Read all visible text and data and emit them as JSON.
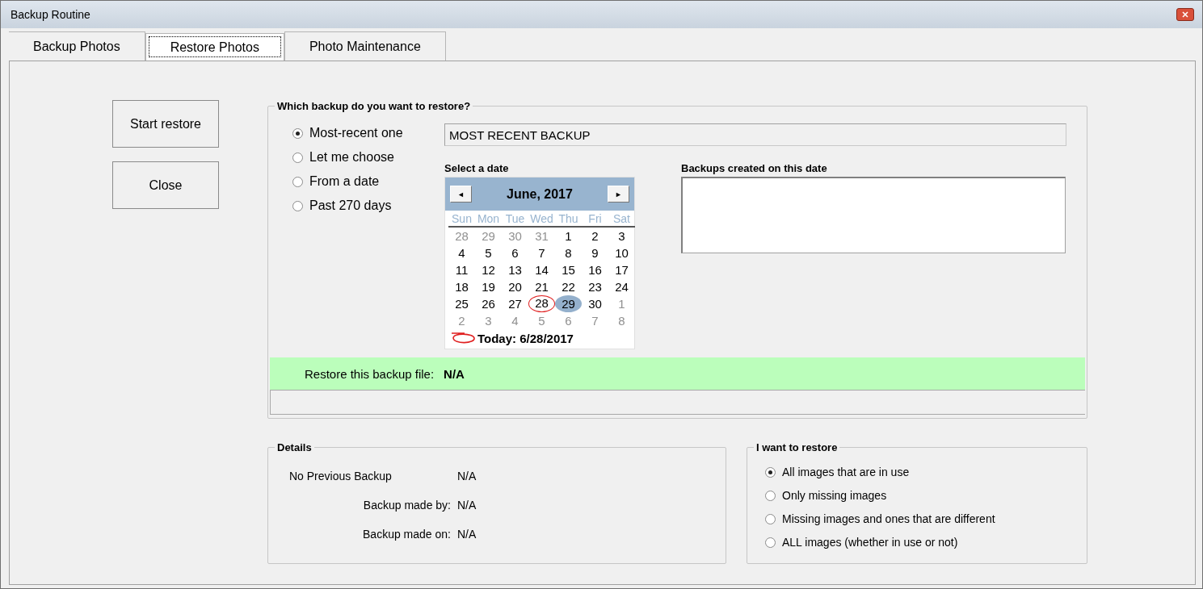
{
  "window": {
    "title": "Backup Routine"
  },
  "tabs": [
    {
      "label": "Backup Photos",
      "selected": false
    },
    {
      "label": "Restore Photos",
      "selected": true
    },
    {
      "label": "Photo Maintenance",
      "selected": false
    }
  ],
  "buttons": [
    "Start restore",
    "Close"
  ],
  "which_backup": {
    "title": "Which backup do you want to restore?",
    "options": [
      {
        "label": "Most-recent one",
        "selected": true
      },
      {
        "label": "Let me choose",
        "selected": false
      },
      {
        "label": "From a date",
        "selected": false
      },
      {
        "label": "Past 270 days",
        "selected": false
      }
    ],
    "backup_field": {
      "value": "MOST RECENT BACKUP"
    },
    "calendar_label": "Select a date",
    "calendar": {
      "month": "June, 2017",
      "prev": "◄",
      "next": "►",
      "weekdays": [
        "Sun",
        "Mon",
        "Tue",
        "Wed",
        "Thu",
        "Fri",
        "Sat"
      ],
      "days": [
        {
          "day": "28",
          "muted": true,
          "selected": false,
          "today": false
        },
        {
          "day": "29",
          "muted": true,
          "selected": false,
          "today": false
        },
        {
          "day": "30",
          "muted": true,
          "selected": false,
          "today": false
        },
        {
          "day": "31",
          "muted": true,
          "selected": false,
          "today": false
        },
        {
          "day": "1",
          "muted": false,
          "selected": false,
          "today": false
        },
        {
          "day": "2",
          "muted": false,
          "selected": false,
          "today": false
        },
        {
          "day": "3",
          "muted": false,
          "selected": false,
          "today": false
        },
        {
          "day": "4",
          "muted": false,
          "selected": false,
          "today": false
        },
        {
          "day": "5",
          "muted": false,
          "selected": false,
          "today": false
        },
        {
          "day": "6",
          "muted": false,
          "selected": false,
          "today": false
        },
        {
          "day": "7",
          "muted": false,
          "selected": false,
          "today": false
        },
        {
          "day": "8",
          "muted": false,
          "selected": false,
          "today": false
        },
        {
          "day": "9",
          "muted": false,
          "selected": false,
          "today": false
        },
        {
          "day": "10",
          "muted": false,
          "selected": false,
          "today": false
        },
        {
          "day": "11",
          "muted": false,
          "selected": false,
          "today": false
        },
        {
          "day": "12",
          "muted": false,
          "selected": false,
          "today": false
        },
        {
          "day": "13",
          "muted": false,
          "selected": false,
          "today": false
        },
        {
          "day": "14",
          "muted": false,
          "selected": false,
          "today": false
        },
        {
          "day": "15",
          "muted": false,
          "selected": false,
          "today": false
        },
        {
          "day": "16",
          "muted": false,
          "selected": false,
          "today": false
        },
        {
          "day": "17",
          "muted": false,
          "selected": false,
          "today": false
        },
        {
          "day": "18",
          "muted": false,
          "selected": false,
          "today": false
        },
        {
          "day": "19",
          "muted": false,
          "selected": false,
          "today": false
        },
        {
          "day": "20",
          "muted": false,
          "selected": false,
          "today": false
        },
        {
          "day": "21",
          "muted": false,
          "selected": false,
          "today": false
        },
        {
          "day": "22",
          "muted": false,
          "selected": false,
          "today": false
        },
        {
          "day": "23",
          "muted": false,
          "selected": false,
          "today": false
        },
        {
          "day": "24",
          "muted": false,
          "selected": false,
          "today": false
        },
        {
          "day": "25",
          "muted": false,
          "selected": false,
          "today": false
        },
        {
          "day": "26",
          "muted": false,
          "selected": false,
          "today": false
        },
        {
          "day": "27",
          "muted": false,
          "selected": false,
          "today": false
        },
        {
          "day": "28",
          "muted": false,
          "selected": false,
          "today": true
        },
        {
          "day": "29",
          "muted": false,
          "selected": true,
          "today": false
        },
        {
          "day": "30",
          "muted": false,
          "selected": false,
          "today": false
        },
        {
          "day": "1",
          "muted": true,
          "selected": false,
          "today": false
        },
        {
          "day": "2",
          "muted": true,
          "selected": false,
          "today": false
        },
        {
          "day": "3",
          "muted": true,
          "selected": false,
          "today": false
        },
        {
          "day": "4",
          "muted": true,
          "selected": false,
          "today": false
        },
        {
          "day": "5",
          "muted": true,
          "selected": false,
          "today": false
        },
        {
          "day": "6",
          "muted": true,
          "selected": false,
          "today": false
        },
        {
          "day": "7",
          "muted": true,
          "selected": false,
          "today": false
        },
        {
          "day": "8",
          "muted": true,
          "selected": false,
          "today": false
        }
      ],
      "today": "Today: 6/28/2017"
    },
    "backups_label": "Backups created on this date",
    "restore_file": {
      "label": "Restore this backup file:",
      "value": "N/A"
    }
  },
  "details": {
    "title": "Details",
    "rows": [
      {
        "label": "No Previous Backup",
        "value": "N/A"
      },
      {
        "label": "Backup made by:",
        "value": "N/A"
      },
      {
        "label": "Backup made on:",
        "value": "N/A"
      }
    ]
  },
  "restore_scope": {
    "title": "I want to restore",
    "options": [
      {
        "label": "All images that are in use",
        "selected": true
      },
      {
        "label": "Only missing images",
        "selected": false
      },
      {
        "label": "Missing images and ones that are different",
        "selected": false
      },
      {
        "label": "ALL images (whether in use or not)",
        "selected": false
      }
    ]
  }
}
